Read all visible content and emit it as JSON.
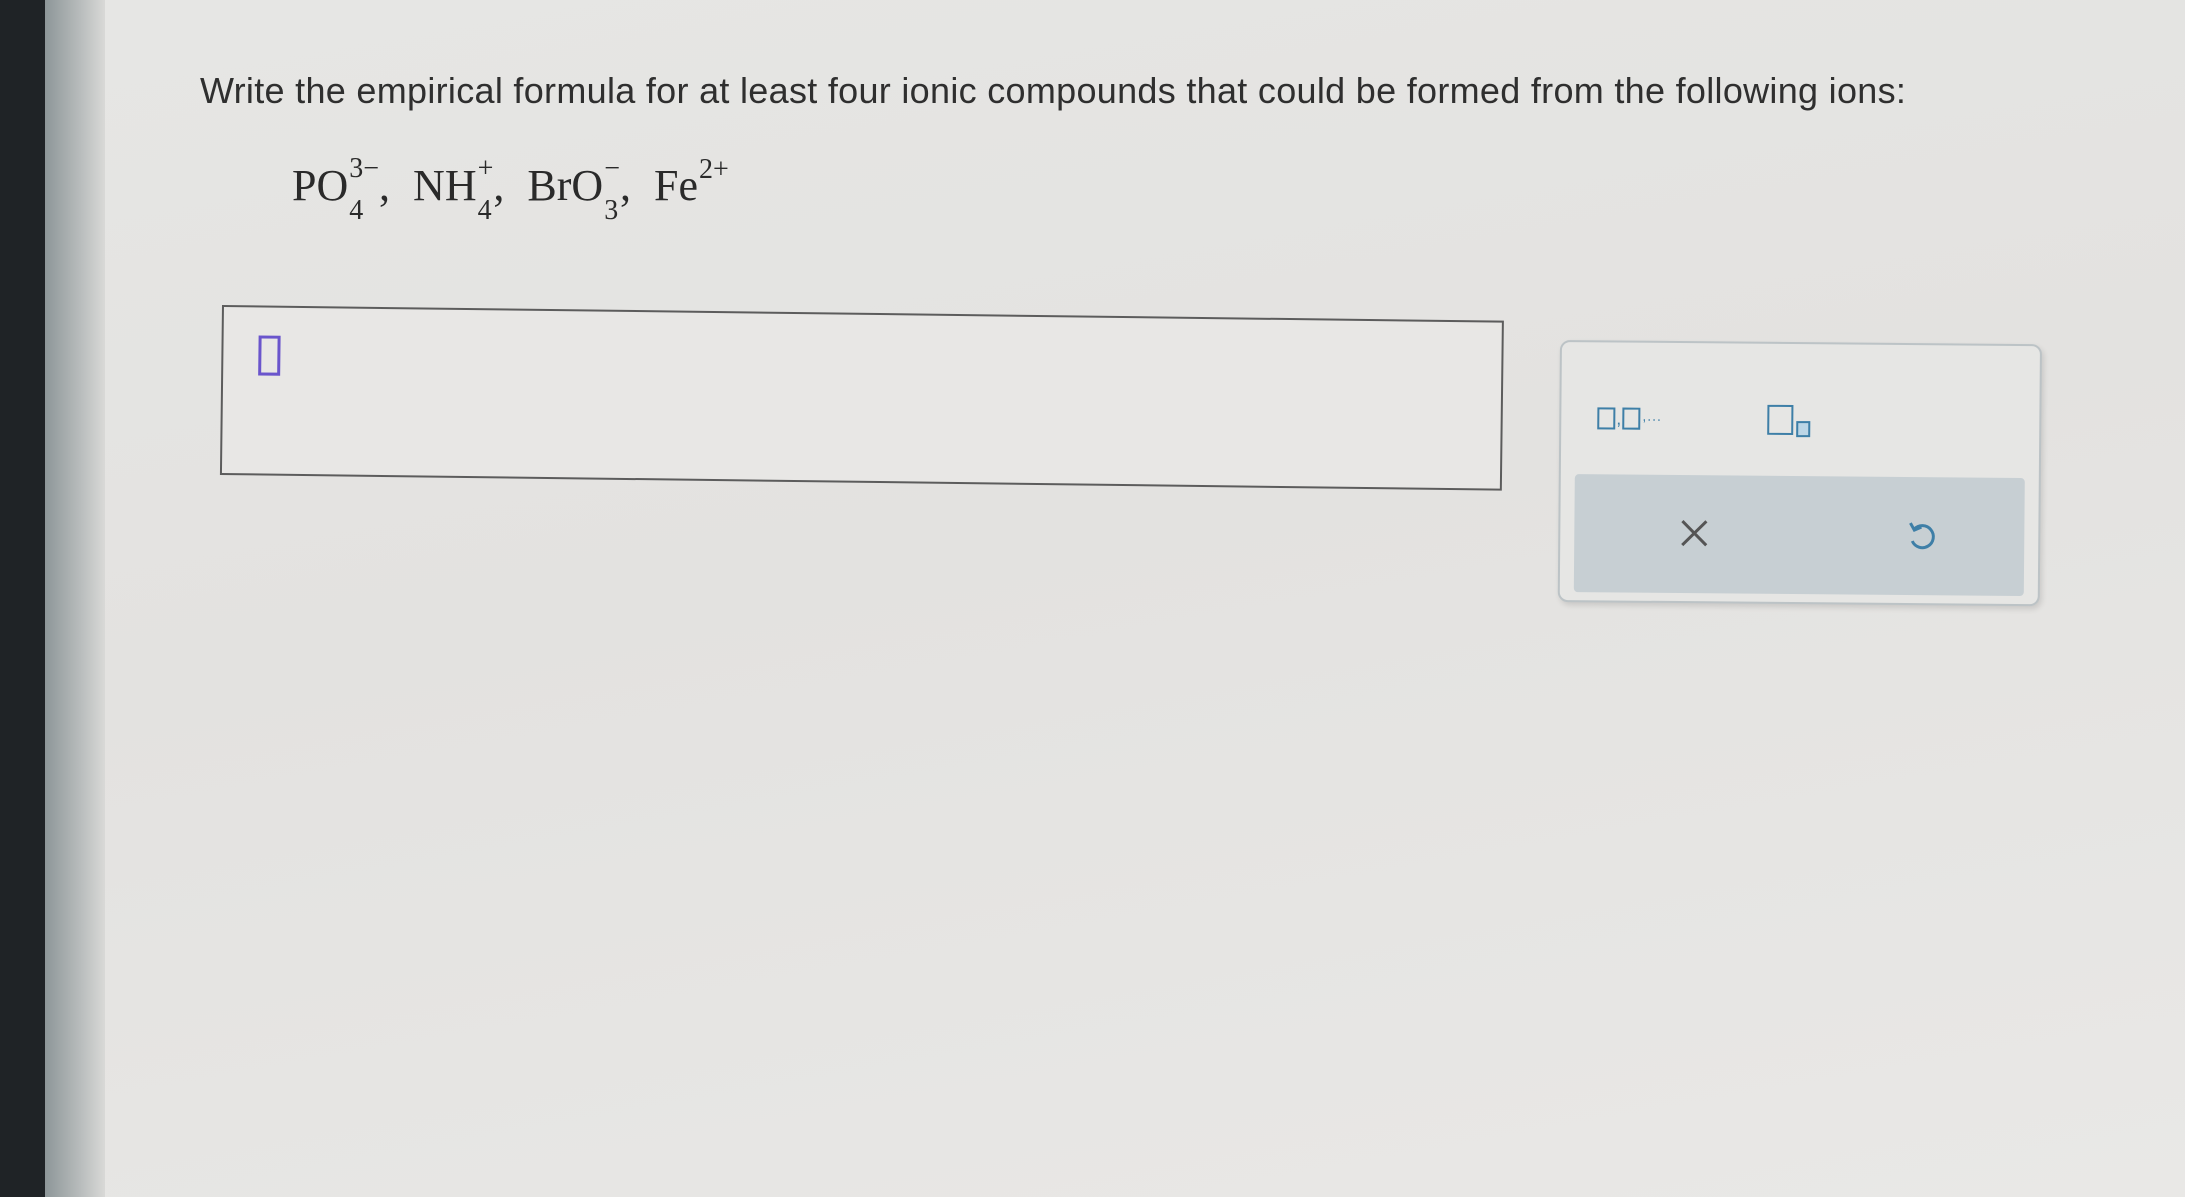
{
  "question": {
    "text": "Write the empirical formula for at least four ionic compounds that could be formed from the following ions:"
  },
  "ions": [
    {
      "base": "PO",
      "sub": "4",
      "sup": "3−",
      "sep": ","
    },
    {
      "base": "NH",
      "sub": "4",
      "sup": "+",
      "sep": ","
    },
    {
      "base": "BrO",
      "sub": "3",
      "sup": "−",
      "sep": ","
    },
    {
      "base": "Fe",
      "sup": "2+",
      "sep": ""
    }
  ],
  "answer": {
    "value": ""
  },
  "toolbar": {
    "list_icon": "comma-separated-list-icon",
    "superscript_icon": "superscript-box-icon",
    "clear_icon": "close-icon",
    "undo_icon": "undo-icon",
    "icon_color": "#3e7fa7",
    "cursor_color": "#6a55cc"
  }
}
